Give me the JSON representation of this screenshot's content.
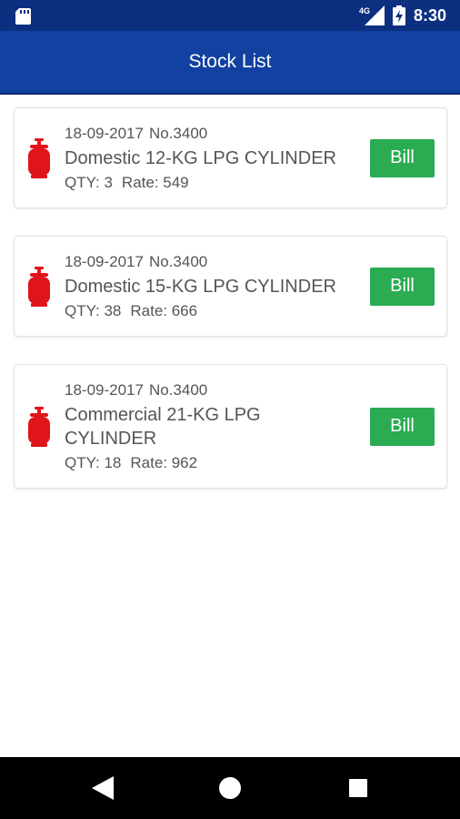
{
  "status_bar": {
    "network_label": "4G",
    "time": "8:30"
  },
  "app_bar": {
    "title": "Stock List"
  },
  "icon_names": {
    "sd": "sd-card-icon",
    "signal": "signal-icon",
    "battery": "battery-charging-icon",
    "cylinder": "gas-cylinder-icon",
    "back": "back-icon",
    "home": "home-icon",
    "recent": "recent-apps-icon"
  },
  "colors": {
    "status_bar": "#0c2f80",
    "app_bar": "#1241a1",
    "bill_button": "#2bab52",
    "cylinder": "#e0141b"
  },
  "stock_items": [
    {
      "date": "18-09-2017",
      "number": "No.3400",
      "name": "Domestic 12-KG LPG CYLINDER",
      "qty": "QTY: 3",
      "rate": "Rate: 549",
      "bill_label": "Bill"
    },
    {
      "date": "18-09-2017",
      "number": "No.3400",
      "name": "Domestic 15-KG LPG CYLINDER",
      "qty": "QTY: 38",
      "rate": "Rate: 666",
      "bill_label": "Bill"
    },
    {
      "date": "18-09-2017",
      "number": "No.3400",
      "name": "Commercial 21-KG LPG CYLINDER",
      "qty": "QTY: 18",
      "rate": "Rate: 962",
      "bill_label": "Bill"
    }
  ]
}
